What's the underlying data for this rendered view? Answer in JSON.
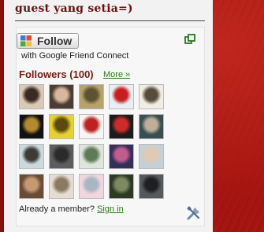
{
  "widget": {
    "title": "guest yang setia=)",
    "follow_label": "Follow",
    "with_text": "with Google Friend Connect",
    "followers_label": "Followers (100)",
    "more_link": "More »",
    "member_prompt": "Already a member?",
    "signin_link": "Sign in"
  },
  "colors": {
    "title": "#6b1010",
    "link": "#2c7a1a",
    "page_background": "#a8170f"
  },
  "icons": {
    "follow_logo": "google-friend-connect-icon",
    "popout": "popout-window-icon",
    "tools": "tools-icon"
  },
  "avatars": [
    {
      "name": "follower-1",
      "colors": [
        "#d9c9b5",
        "#3a2a22"
      ]
    },
    {
      "name": "follower-2",
      "colors": [
        "#4b3c34",
        "#d8b79a"
      ]
    },
    {
      "name": "follower-3",
      "colors": [
        "#b7a36a",
        "#5e5330"
      ]
    },
    {
      "name": "follower-4",
      "colors": [
        "#e9eef4",
        "#c81e1e"
      ]
    },
    {
      "name": "follower-5",
      "colors": [
        "#f0ede3",
        "#574b3b"
      ]
    },
    {
      "name": "follower-6",
      "colors": [
        "#121212",
        "#b48a2e"
      ]
    },
    {
      "name": "follower-7",
      "colors": [
        "#e7d12b",
        "#5a4a10"
      ]
    },
    {
      "name": "follower-8",
      "colors": [
        "#f5f5f5",
        "#c02020"
      ]
    },
    {
      "name": "follower-9",
      "colors": [
        "#1c1c1c",
        "#d02a2a"
      ]
    },
    {
      "name": "follower-10",
      "colors": [
        "#384e52",
        "#bfae98"
      ]
    },
    {
      "name": "follower-11",
      "colors": [
        "#cbd8dc",
        "#3e3a35"
      ]
    },
    {
      "name": "follower-12",
      "colors": [
        "#5d5d5d",
        "#2b2b2b"
      ]
    },
    {
      "name": "follower-13",
      "colors": [
        "#dfe4dd",
        "#5d7b56"
      ]
    },
    {
      "name": "follower-14",
      "colors": [
        "#34305a",
        "#c25c8e"
      ]
    },
    {
      "name": "follower-15",
      "colors": [
        "#c4d0d6",
        "#e2c9b2"
      ]
    },
    {
      "name": "follower-16",
      "colors": [
        "#6a4b34",
        "#c69973"
      ]
    },
    {
      "name": "follower-17",
      "colors": [
        "#e6ddd0",
        "#8a7a64"
      ]
    },
    {
      "name": "follower-18",
      "colors": [
        "#f2d6dd",
        "#a8b6c4"
      ]
    },
    {
      "name": "follower-19",
      "colors": [
        "#2c3a24",
        "#7c8a60"
      ]
    },
    {
      "name": "follower-20",
      "colors": [
        "#56595c",
        "#1d1f22"
      ]
    }
  ]
}
